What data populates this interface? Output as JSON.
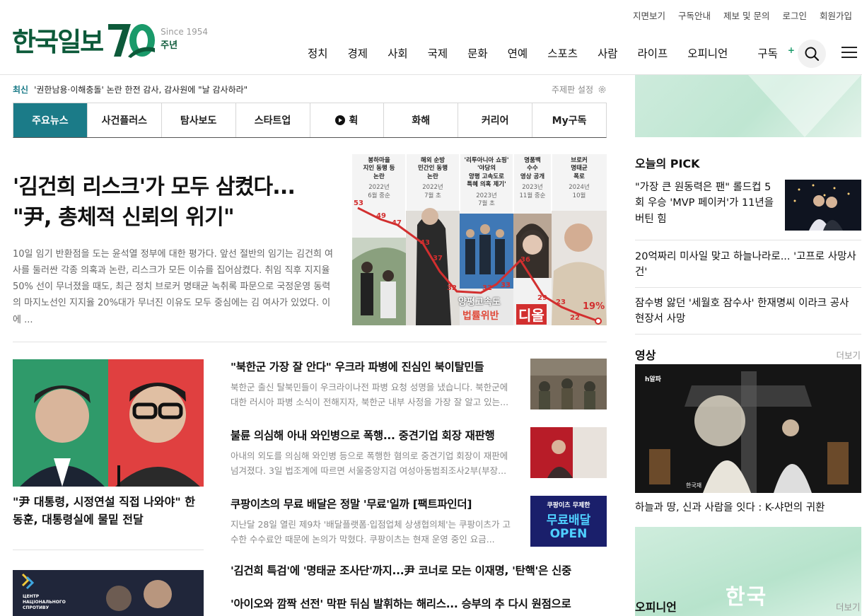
{
  "util_links": [
    "지면보기",
    "구독안내",
    "제보 및 문의",
    "로그인",
    "회원가입"
  ],
  "logo": {
    "text": "한국일보",
    "since": "Since 1954",
    "anniversary": "주년",
    "anniversary_number": "70",
    "brand_color": "#0d5a3a",
    "accent": "#1a9a6a"
  },
  "gnb": [
    "정치",
    "경제",
    "사회",
    "국제",
    "문화",
    "연예",
    "스포츠",
    "사람",
    "라이프",
    "오피니언",
    "구독"
  ],
  "gnb_plus": "+",
  "ticker": {
    "label": "최신",
    "text": "'권한남용·이해충돌' 논란 한전 감사, 감사원에 \"날 감사하라\"",
    "setting": "주제판 설정"
  },
  "tabs": [
    "주요뉴스",
    "사건플러스",
    "탐사보도",
    "스타트업",
    "휙",
    "화해",
    "커리어",
    "My구독"
  ],
  "tab_active_color": "#1b7b88",
  "lead": {
    "title_line1": "'김건희 리스크'가 모두 삼켰다...",
    "title_line2": "\"尹, 총체적 신뢰의 위기\"",
    "summary": "10일 임기 반환점을 도는 윤석열 정부에 대한 평가다. 앞선 절반의 임기는 김건희 여사를 둘러싼 각종 의혹과 논란, 리스크가 모든 이슈를 집어삼켰다. 취임 직후 지지율 50% 선이 무너졌을 때도, 최근 정치 브로커 명태균 녹취록 파문으로 국정운영 동력의 마지노선인 지지율 20%대가 무너진 이유도 모두 중심에는 김 여사가 있었다. 이에 ...",
    "graphic": {
      "columns": [
        {
          "head": [
            "봉하마을",
            "지인 동행 등",
            "논란"
          ],
          "date": [
            "2022년",
            "6월 중순"
          ]
        },
        {
          "head": [
            "해외 순방",
            "민간인 동행",
            "논란"
          ],
          "date": [
            "2022년",
            "7월 초"
          ]
        },
        {
          "head": [
            "'리투아니아 쇼핑'",
            "'야당의",
            "양평 고속도로",
            "특혜 의혹 제기'"
          ],
          "date": [
            "2023년",
            "7월 초"
          ]
        },
        {
          "head": [
            "명품백",
            "수수",
            "영상 공개"
          ],
          "date": [
            "2023년",
            "11월 중순"
          ]
        },
        {
          "head": [
            "브로커",
            "명태균",
            "폭로"
          ],
          "date": [
            "2024년",
            "10월"
          ]
        }
      ],
      "values": [
        "53",
        "49",
        "47",
        "43",
        "37",
        "32",
        "32",
        "33",
        "36",
        "29",
        "23",
        "22",
        "19%"
      ],
      "overlay_1": "양평고속도",
      "overlay_2": "법률위반",
      "overlay_3": "디올"
    }
  },
  "second": {
    "title": "\"尹 대통령, 시정연설 직접 나와야\" 한동훈, 대통령실에 물밑 전달"
  },
  "articles": [
    {
      "title": "\"북한군 가장 잘 안다\" 우크라 파병에 진심인 북이탈민들",
      "desc": "북한군 출신 탈북민들이 우크라이나전 파병 요청 성명을 냈습니다. 북한군에 대한 러시아 파병 소식이 전해지자, 북한군 내부 사정을 가장 잘 알고 있는..."
    },
    {
      "title": "불륜 의심해 아내 와인병으로 폭행... 중견기업 회장 재판행",
      "desc": "아내의 외도를 의심해 와인병 등으로 폭행한 혐의로 중견기업 회장이 재판에 넘겨졌다. 3일 법조계에 따르면 서울중앙지검 여성아동범죄조사2부(부장..."
    },
    {
      "title": "쿠팡이츠의 무료 배달은 정말 '무료'일까 [팩트파인더]",
      "desc": "지난달 28일 열린 제9차 '배달플랫폼·입점업체 상생협의체'는 쿠팡이츠가 고수한 수수료안 때문에 논의가 막혔다. 쿠팡이츠는 현재 운영 중인 요금...",
      "thumb_text": [
        "쿠팡이츠 무제한",
        "무료배달",
        "OPEN"
      ]
    }
  ],
  "headlines": [
    "'김건희 특검'에 '명태균 조사단'까지...尹 코너로 모는 이재명, '탄핵'은 신중",
    "'아이오와 깜짝 선전' 막판 뒤심 발휘하는 해리스... 승부의 추 다시 원점으로"
  ],
  "photo3_caption": [
    "ЦЕНТР",
    "НАЦІОНАЛЬНОГО",
    "СПРОТИВУ"
  ],
  "right": {
    "pick_title": "오늘의 PICK",
    "picks": [
      "\"가장 큰 원동력은 팬\" 롤드컵 5회 우승 'MVP 페이커'가 11년을 버틴 힘",
      "20억짜리 미사일 맞고 하늘나라로... '고프로 사망사건'",
      "잠수병 앓던 '세월호 잠수사' 한재명씨 이라크 공사 현장서 사망"
    ],
    "video_title": "영상",
    "more_label": "더보기",
    "video_caption": "하늘과 땅, 신과 사람을 잇다 : K-샤먼의 귀환",
    "video_watermark": "h알파",
    "video_logo": "한국재",
    "ad_brand": "한국",
    "opinion_title": "오피니언"
  }
}
